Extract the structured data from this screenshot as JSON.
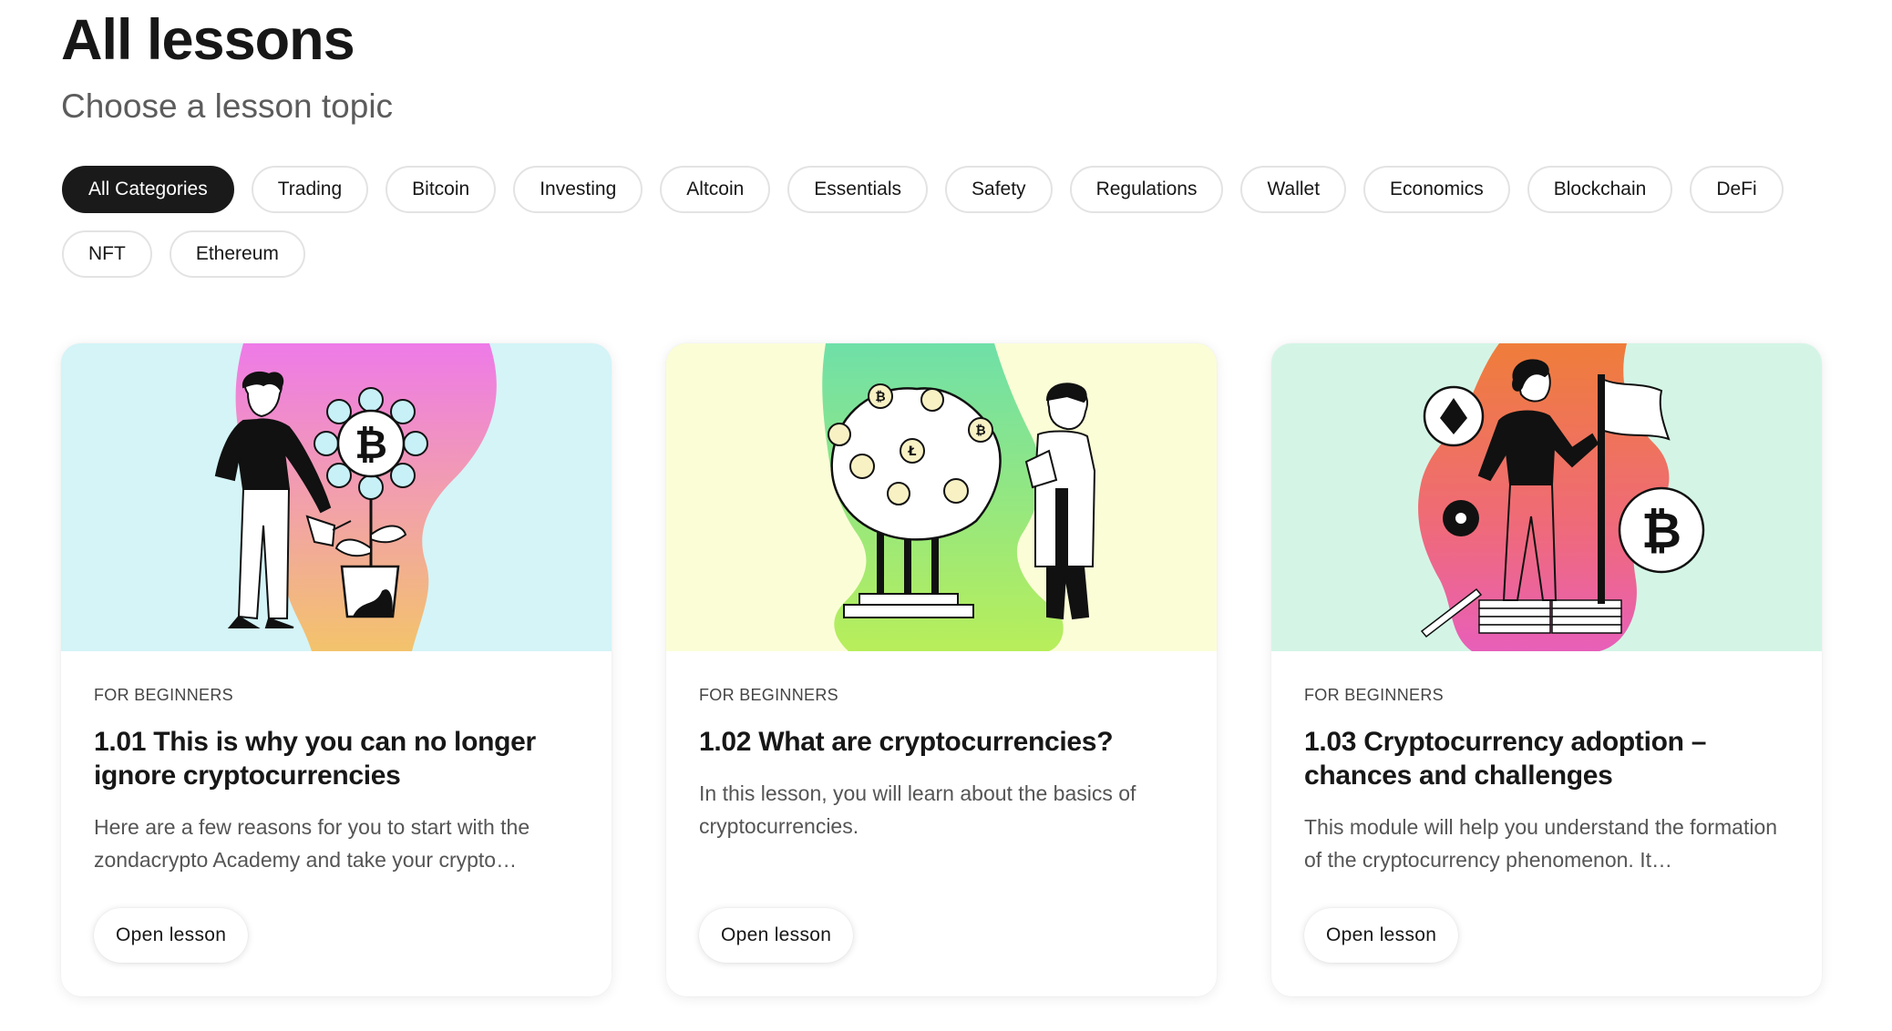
{
  "header": {
    "title": "All lessons",
    "subtitle": "Choose a lesson topic"
  },
  "categories": [
    {
      "label": "All Categories",
      "active": true
    },
    {
      "label": "Trading"
    },
    {
      "label": "Bitcoin"
    },
    {
      "label": "Investing"
    },
    {
      "label": "Altcoin"
    },
    {
      "label": "Essentials"
    },
    {
      "label": "Safety"
    },
    {
      "label": "Regulations"
    },
    {
      "label": "Wallet"
    },
    {
      "label": "Economics"
    },
    {
      "label": "Blockchain"
    },
    {
      "label": "DeFi"
    },
    {
      "label": "NFT"
    },
    {
      "label": "Ethereum"
    }
  ],
  "lessons": [
    {
      "level": "FOR BEGINNERS",
      "title": "1.01 This is why you can no longer ignore cryptocurrencies",
      "description": "Here are a few reasons for you to start with the zondacrypto Academy and take your crypto…",
      "button": "Open lesson",
      "art_bg": "#d4f4f7"
    },
    {
      "level": "FOR BEGINNERS",
      "title": "1.02 What are cryptocurrencies?",
      "description": "In this lesson, you will learn about the basics of cryptocurrencies.",
      "button": "Open lesson",
      "art_bg": "#fbfdd7"
    },
    {
      "level": "FOR BEGINNERS",
      "title": "1.03 Cryptocurrency adoption – chances and challenges",
      "description": "This module will help you understand the formation of the cryptocurrency phenomenon. It…",
      "button": "Open lesson",
      "art_bg": "#d4f5e6"
    }
  ],
  "icons": {
    "bitcoin": "bitcoin-icon",
    "ethereum": "ethereum-icon",
    "cardano": "cardano-icon"
  }
}
